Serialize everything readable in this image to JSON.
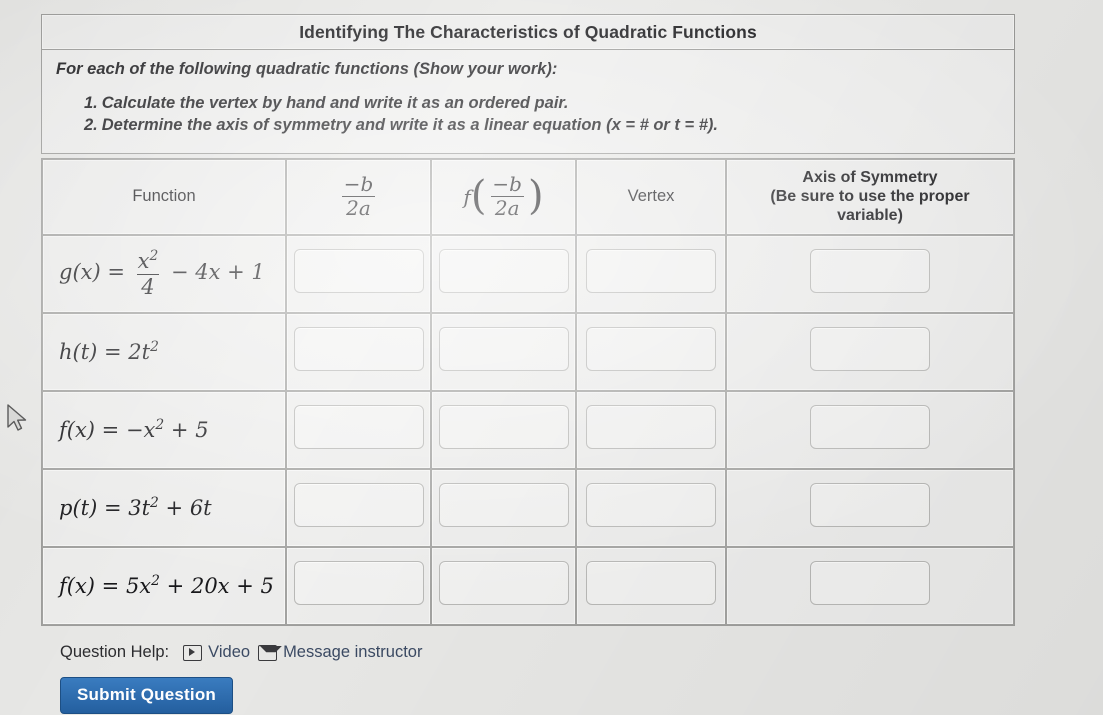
{
  "worksheet": {
    "title": "Identifying The Characteristics of Quadratic Functions",
    "instructions_lead": "For each of the following quadratic functions (Show your work):",
    "instructions": [
      {
        "num": "1.",
        "text": "Calculate the vertex by hand and write it as an ordered pair."
      },
      {
        "num": "2.",
        "text": "Determine the axis of symmetry and write it as a linear equation (x = # or t = #)."
      }
    ]
  },
  "table": {
    "headers": {
      "function": "Function",
      "minus_b_over_2a": "-b/2a",
      "f_of_minus_b_over_2a": "f(-b/2a)",
      "vertex": "Vertex",
      "axis_line1": "Axis of Symmetry",
      "axis_line2": "(Be sure to use the proper",
      "axis_line3": "variable)"
    },
    "rows": [
      {
        "function": "g(x) = x²/4 - 4x + 1",
        "col2": "",
        "col3": "",
        "vertex": "",
        "axis": ""
      },
      {
        "function": "h(t) = 2t²",
        "col2": "",
        "col3": "",
        "vertex": "",
        "axis": ""
      },
      {
        "function": "f(x) = -x² + 5",
        "col2": "",
        "col3": "",
        "vertex": "",
        "axis": ""
      },
      {
        "function": "p(t) = 3t² + 6t",
        "col2": "",
        "col3": "",
        "vertex": "",
        "axis": ""
      },
      {
        "function": "f(x) = 5x² + 20x + 5",
        "col2": "",
        "col3": "",
        "vertex": "",
        "axis": ""
      }
    ]
  },
  "footer": {
    "help_label": "Question Help:",
    "video_link": "Video",
    "message_link": "Message instructor",
    "submit_label": "Submit Question"
  },
  "colors": {
    "page_background": "#e8e8e6",
    "panel_background": "#ededec",
    "submit_button": "#2a6cb3",
    "link_text": "#3b4a63",
    "border": "#a3a3a1"
  }
}
